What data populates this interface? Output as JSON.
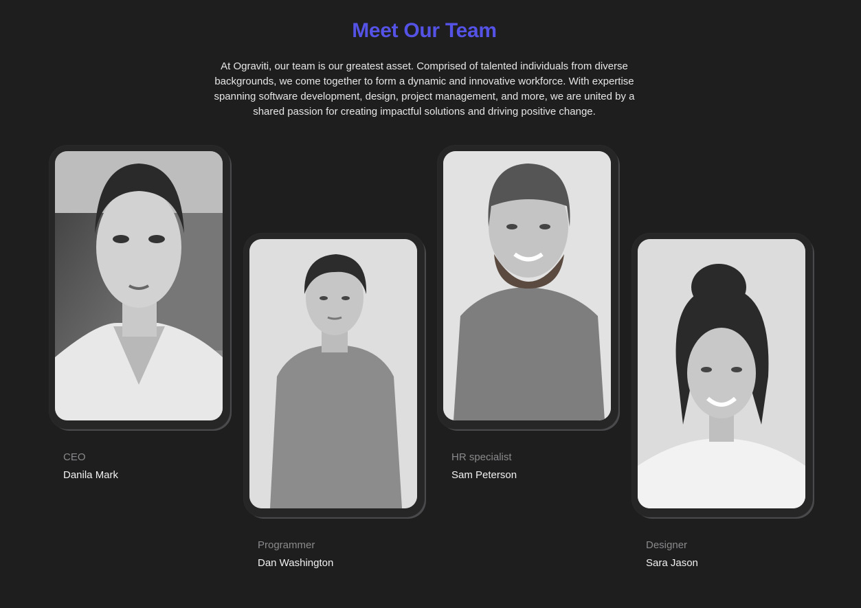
{
  "section": {
    "title": "Meet Our Team",
    "description": "At Ograviti, our team is our greatest asset. Comprised of talented individuals from diverse backgrounds, we come together to form a dynamic and innovative workforce. With expertise spanning software development, design, project management, and more, we are united by a shared passion for creating impactful solutions and driving positive change."
  },
  "team": [
    {
      "role": "CEO",
      "name": "Danila Mark"
    },
    {
      "role": "Programmer",
      "name": "Dan Washington"
    },
    {
      "role": "HR specialist",
      "name": "Sam Peterson"
    },
    {
      "role": "Designer",
      "name": "Sara Jason"
    }
  ],
  "colors": {
    "accent": "#5552e6",
    "background": "#1e1e1f"
  }
}
